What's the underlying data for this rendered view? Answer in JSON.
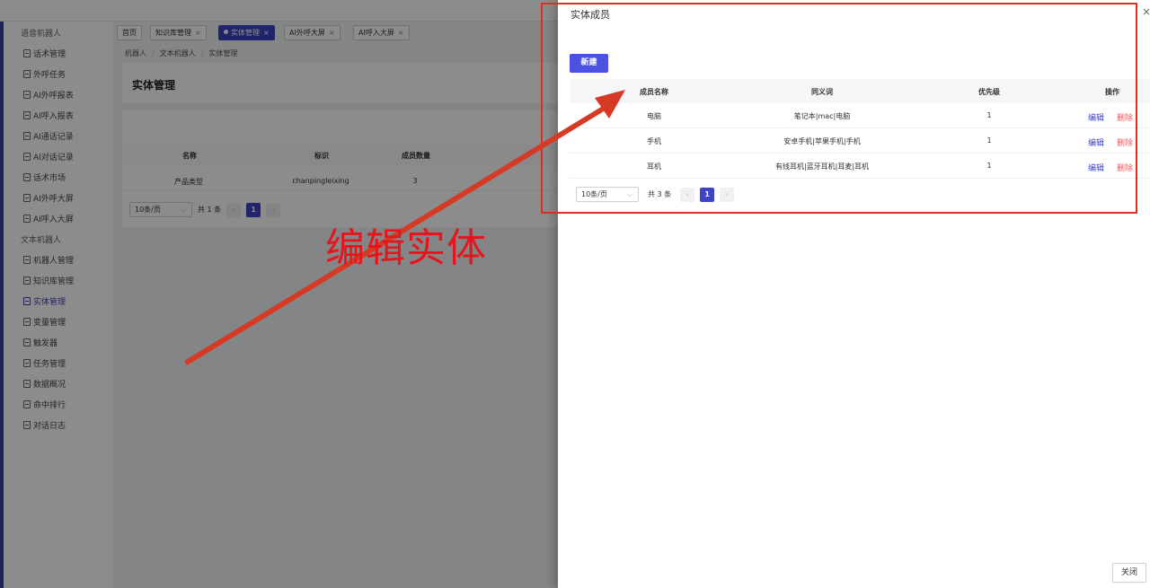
{
  "sidebar": {
    "groups": [
      {
        "label": "语音机器人",
        "items": [
          "话术管理",
          "外呼任务",
          "AI外呼报表",
          "AI呼入报表",
          "AI通话记录",
          "AI对话记录",
          "话术市场",
          "AI外呼大屏",
          "AI呼入大屏"
        ]
      },
      {
        "label": "文本机器人",
        "items": [
          "机器人管理",
          "知识库管理",
          "实体管理",
          "变量管理",
          "触发器",
          "任务管理",
          "数据概况",
          "命中排行",
          "对话日志"
        ]
      }
    ],
    "active_item": "实体管理"
  },
  "tabs": [
    {
      "label": "首页",
      "closable": false,
      "active": false
    },
    {
      "label": "知识库管理",
      "closable": true,
      "active": false
    },
    {
      "label": "实体管理",
      "closable": true,
      "active": true
    },
    {
      "label": "AI外呼大屏",
      "closable": true,
      "active": false
    },
    {
      "label": "AI呼入大屏",
      "closable": true,
      "active": false
    }
  ],
  "tab_close_glyph": "×",
  "breadcrumb": [
    "机器人",
    "文本机器人",
    "实体管理"
  ],
  "breadcrumb_sep": "/",
  "page_title": "实体管理",
  "entity_table": {
    "columns": [
      "名称",
      "标识",
      "成员数量"
    ],
    "rows": [
      [
        "产品类型",
        "chanpingleixing",
        "3"
      ]
    ]
  },
  "entity_pager": {
    "page_size": "10条/页",
    "total": "共 1 条",
    "current_page": "1"
  },
  "drawer": {
    "title": "实体成员",
    "close_glyph": "×",
    "new_button": "新建",
    "columns": [
      "成员名称",
      "同义词",
      "优先级",
      "操作"
    ],
    "rows": [
      {
        "name": "电脑",
        "synonyms": "笔记本|mac|电脑",
        "priority": "1"
      },
      {
        "name": "手机",
        "synonyms": "安卓手机|苹果手机|手机",
        "priority": "1"
      },
      {
        "name": "耳机",
        "synonyms": "有线耳机|蓝牙耳机|耳麦|耳机",
        "priority": "1"
      }
    ],
    "row_actions": {
      "edit": "编辑",
      "delete": "删除"
    },
    "pager": {
      "page_size": "10条/页",
      "total": "共 3 条",
      "current_page": "1"
    },
    "close_button": "关闭"
  },
  "annotation": {
    "text": "编辑实体",
    "color": "#e8141c"
  },
  "pager_glyphs": {
    "caret": "⌵",
    "prev": "‹",
    "next": "›"
  },
  "colors": {
    "accent": "#3d43c7",
    "primary_button": "#4b51e0",
    "danger": "#ef5a5a",
    "annotation_red": "#d9301f"
  }
}
